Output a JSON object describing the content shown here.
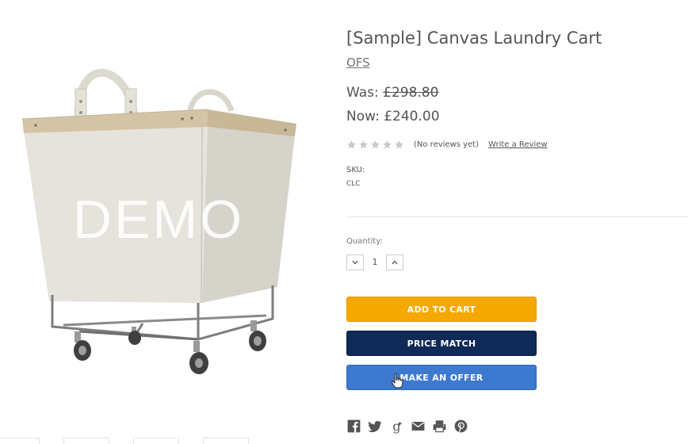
{
  "product": {
    "title": "[Sample] Canvas Laundry Cart",
    "brand": "OFS",
    "image": {
      "icon": "canvas-laundry-cart-image",
      "watermark": "DEMO"
    }
  },
  "pricing": {
    "was_label": "Was:",
    "was_value": "£298.80",
    "now_label": "Now:",
    "now_value": "£240.00"
  },
  "reviews": {
    "rating": 0,
    "max_rating": 5,
    "no_reviews_text": "(No reviews yet)",
    "write_review_label": "Write a Review"
  },
  "sku": {
    "label": "SKU:",
    "value": "CLC"
  },
  "quantity": {
    "label": "Quantity:",
    "value": "1"
  },
  "buttons": {
    "add_to_cart": "ADD TO CART",
    "price_match": "PRICE MATCH",
    "make_an_offer": "MAKE AN OFFER"
  },
  "share": {
    "icons": [
      "facebook-icon",
      "twitter-icon",
      "google-plus-icon",
      "email-icon",
      "print-icon",
      "pinterest-icon"
    ]
  },
  "colors": {
    "add_to_cart": "#f5a800",
    "price_match": "#0f2a56",
    "make_an_offer": "#3d79cf",
    "text": "#545454",
    "star_empty": "#c8c8c8"
  }
}
